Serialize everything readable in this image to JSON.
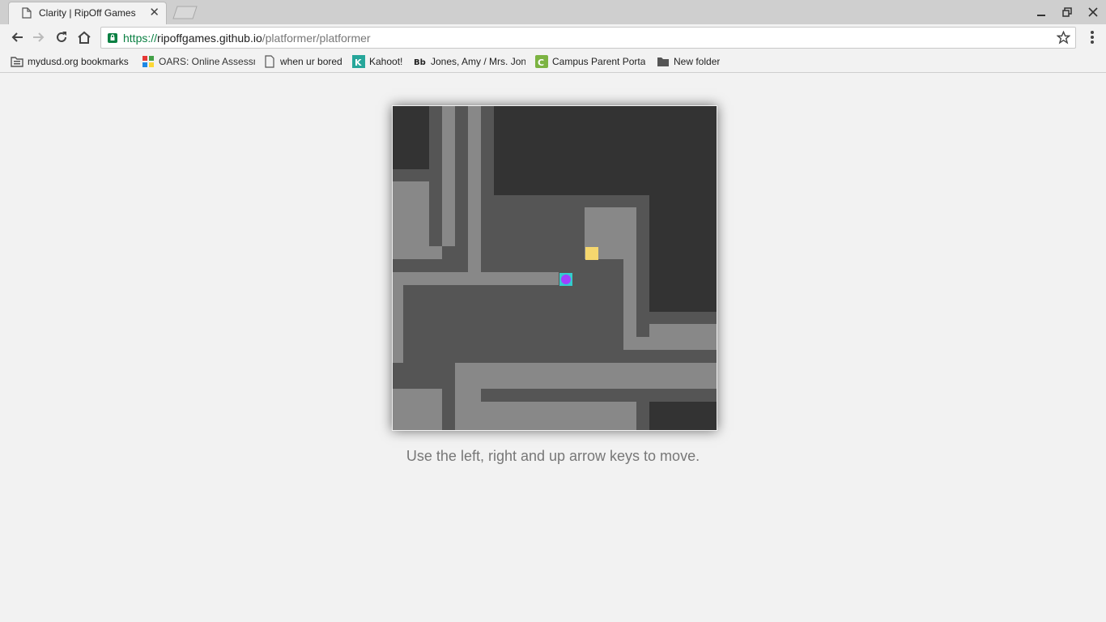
{
  "browser": {
    "tab": {
      "title": "Clarity | RipOff Games",
      "icon": "page-icon",
      "close_label": "✕"
    },
    "window_controls": [
      "minimize-icon",
      "restore-icon",
      "close-icon"
    ],
    "omnibox": {
      "url_scheme": "https://",
      "url_host": "ripoffgames.github.io",
      "url_path": "/platformer/platformer",
      "secure": true
    },
    "bookmarks": [
      {
        "label": "mydusd.org bookmarks",
        "icon": "folder-icon"
      },
      {
        "label": "OARS: Online Assessm",
        "icon": "oars-icon"
      },
      {
        "label": "when ur bored",
        "icon": "page-icon"
      },
      {
        "label": "Kahoot!",
        "icon": "kahoot-icon"
      },
      {
        "label": "Jones, Amy / Mrs. Jon",
        "icon": "blackboard-icon"
      },
      {
        "label": "Campus Parent Porta",
        "icon": "campus-icon"
      },
      {
        "label": "New folder",
        "icon": "folder-icon"
      }
    ]
  },
  "game": {
    "instructions": "Use the left, right and up arrow keys to move.",
    "colors": {
      "wall_dark": "#333333",
      "wall_light": "#888888",
      "floor": "#555555",
      "coin": "#f5d76e",
      "player_outline": "#33cccc",
      "player_core": "#a040ff"
    }
  }
}
